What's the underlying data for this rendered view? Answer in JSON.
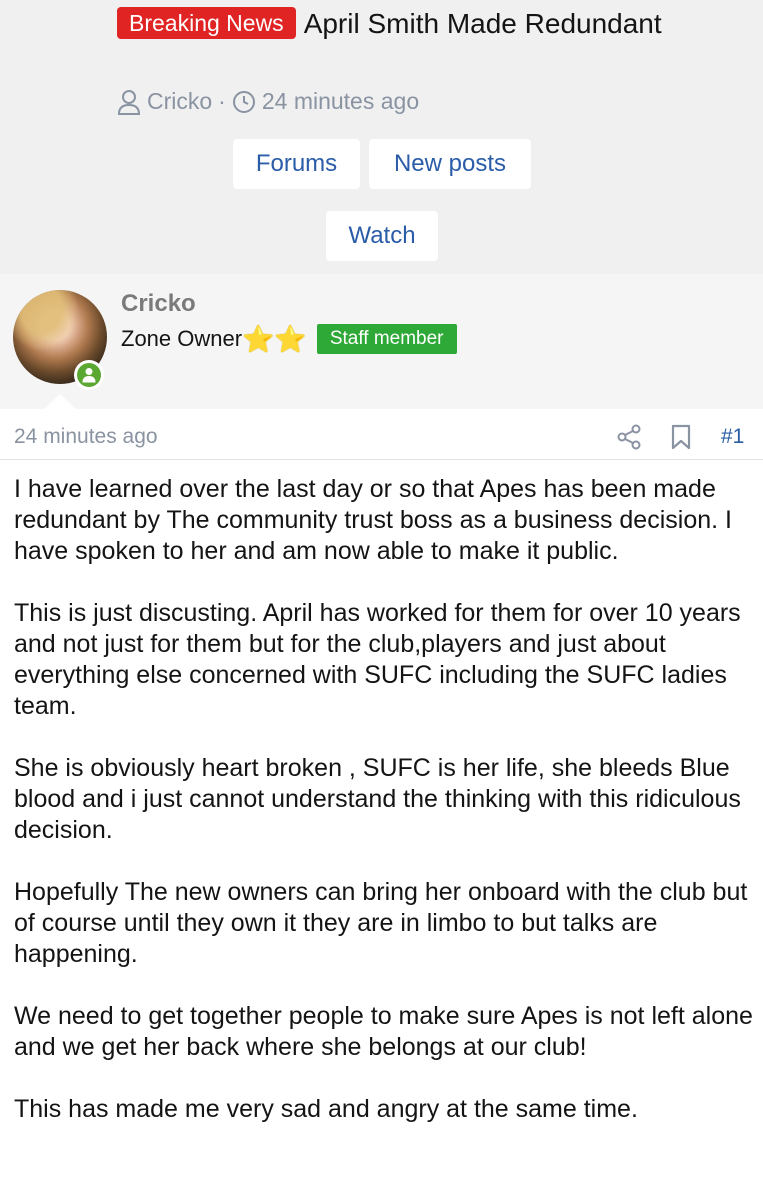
{
  "thread": {
    "prefix": "Breaking News",
    "title": "April Smith Made Redundant",
    "author": "Cricko",
    "time": "24 minutes ago"
  },
  "buttons": {
    "forums": "Forums",
    "new_posts": "New posts",
    "watch": "Watch"
  },
  "post": {
    "username": "Cricko",
    "user_title": "Zone Owner",
    "stars": "⭐⭐",
    "staff_badge": "Staff member",
    "time": "24 minutes ago",
    "number": "#1",
    "paragraphs": [
      "I have learned over the last day or so that Apes has been made redundant by The community trust boss as a business decision. I have spoken to her and am now able to make it public.",
      "This is just discusting. April has worked for them for over 10 years and not just for them but for the club,players and just about everything else concerned with SUFC including the SUFC ladies team.",
      "She is obviously heart broken , SUFC is her life, she bleeds Blue blood and i just cannot understand the thinking with this ridiculous decision.",
      "Hopefully The new owners can bring her onboard with the club but of course until they own it they are in limbo to but talks are happening.",
      "We need to get together people to make sure Apes is not left alone and we get her back where she belongs at our club!",
      "This has made me very sad and angry at the same time."
    ]
  },
  "colors": {
    "breaking_badge": "#e02424",
    "staff_badge": "#2ea836",
    "link": "#2a5ca8",
    "meta": "#8a93a2",
    "online": "#5aa832"
  },
  "icons": [
    "user-icon",
    "clock-icon",
    "share-icon",
    "bookmark-icon",
    "online-status-icon"
  ]
}
